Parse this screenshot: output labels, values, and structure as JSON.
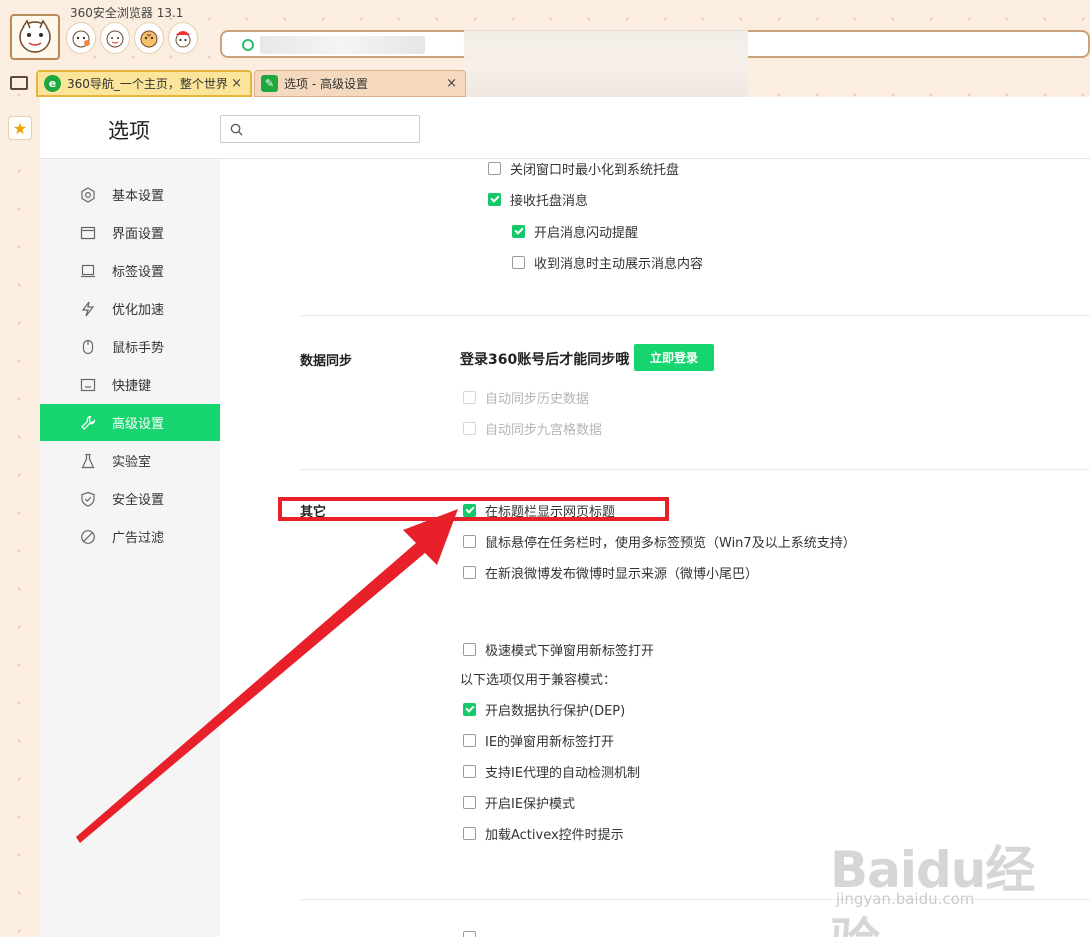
{
  "app": {
    "title": "360安全浏览器 13.1"
  },
  "tabs": [
    {
      "label": "360导航_一个主页，整个世界",
      "close": "×"
    },
    {
      "label": "选项 - 高级设置",
      "close": "×"
    }
  ],
  "options": {
    "title": "选项",
    "search_placeholder": ""
  },
  "sidebar": {
    "items": [
      {
        "label": "基本设置",
        "icon": "gear-icon"
      },
      {
        "label": "界面设置",
        "icon": "window-icon"
      },
      {
        "label": "标签设置",
        "icon": "tab-icon"
      },
      {
        "label": "优化加速",
        "icon": "lightning-icon"
      },
      {
        "label": "鼠标手势",
        "icon": "mouse-icon"
      },
      {
        "label": "快捷键",
        "icon": "keyboard-icon"
      },
      {
        "label": "高级设置",
        "icon": "wrench-icon",
        "active": true
      },
      {
        "label": "实验室",
        "icon": "flask-icon"
      },
      {
        "label": "安全设置",
        "icon": "shield-icon"
      },
      {
        "label": "广告过滤",
        "icon": "block-icon"
      }
    ]
  },
  "tray": {
    "items": [
      {
        "label": "关闭窗口时最小化到系统托盘",
        "checked": false
      },
      {
        "label": "接收托盘消息",
        "checked": true
      },
      {
        "label": "开启消息闪动提醒",
        "checked": true
      },
      {
        "label": "收到消息时主动展示消息内容",
        "checked": false
      }
    ]
  },
  "sync": {
    "label": "数据同步",
    "notice": "登录360账号后才能同步哦",
    "login_button": "立即登录",
    "items": [
      {
        "label": "自动同步历史数据",
        "checked": false,
        "disabled": true
      },
      {
        "label": "自动同步九宫格数据",
        "checked": false,
        "disabled": true
      }
    ]
  },
  "other": {
    "label": "其它",
    "items": [
      {
        "label": "在标题栏显示网页标题",
        "checked": true
      },
      {
        "label": "鼠标悬停在任务栏时，使用多标签预览（Win7及以上系统支持）",
        "checked": false
      },
      {
        "label": "在新浪微博发布微博时显示来源（微博小尾巴）",
        "checked": false
      },
      {
        "label": "极速模式下弹窗用新标签打开",
        "checked": false
      }
    ],
    "compat_note": "以下选项仅用于兼容模式：",
    "compat_items": [
      {
        "label": "开启数据执行保护(DEP)",
        "checked": true
      },
      {
        "label": "IE的弹窗用新标签打开",
        "checked": false
      },
      {
        "label": "支持IE代理的自动检测机制",
        "checked": false
      },
      {
        "label": "开启IE保护模式",
        "checked": false
      },
      {
        "label": "加载Activex控件时提示",
        "checked": false
      }
    ]
  },
  "annotation": {
    "highlight_color": "#e8202a",
    "arrow_color": "#e8202a"
  },
  "watermark": {
    "logo": "Baidu经验",
    "url": "jingyan.baidu.com"
  }
}
